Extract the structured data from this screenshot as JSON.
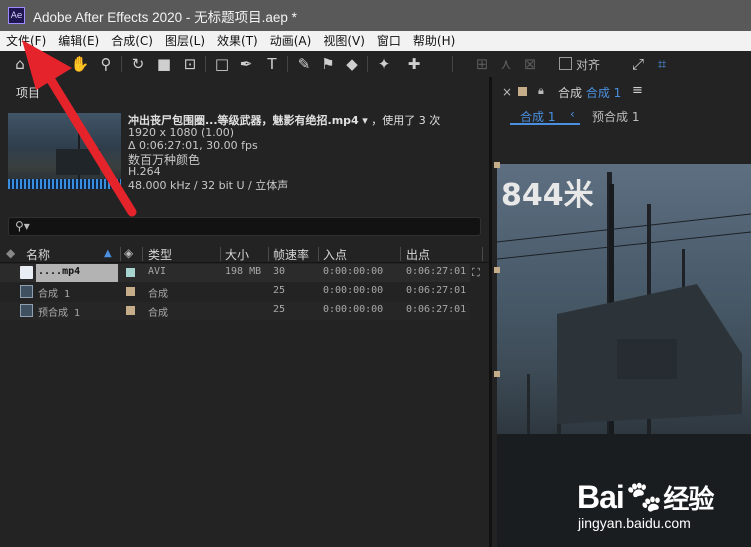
{
  "app": {
    "logo_text": "Ae",
    "title": "Adobe After Effects 2020 - 无标题项目.aep *"
  },
  "menu": [
    "文件(F)",
    "编辑(E)",
    "合成(C)",
    "图层(L)",
    "效果(T)",
    "动画(A)",
    "视图(V)",
    "窗口",
    "帮助(H)"
  ],
  "toolbar": {
    "snap_label": "对齐"
  },
  "project": {
    "panel_title": "项目",
    "selected_name": "冲出丧尸包围圈...等级武器，魅影有绝招.mp4",
    "used_text": "，使用了 3 次",
    "resolution": "1920 x 1080 (1.00)",
    "duration": "Δ 0:06:27:01, 30.00 fps",
    "colors": "数百万种颜色",
    "codec": "H.264",
    "audio": "48.000 kHz / 32 bit U / 立体声",
    "search_icon_text": "⚲▾",
    "columns": {
      "name": "名称",
      "type": "类型",
      "size": "大小",
      "fps": "帧速率",
      "in": "入点",
      "out": "出点"
    },
    "rows": [
      {
        "name": "....mp4",
        "type": "AVI",
        "size": "198 MB",
        "fps": "30",
        "in": "0:00:00:00",
        "out": "0:06:27:01",
        "label_color": "#a8d4d0"
      },
      {
        "name": "合成 1",
        "type": "合成",
        "size": "",
        "fps": "25",
        "in": "0:00:00:00",
        "out": "0:06:27:01",
        "label_color": "#c5ad8a"
      },
      {
        "name": "预合成 1",
        "type": "合成",
        "size": "",
        "fps": "25",
        "in": "0:00:00:00",
        "out": "0:06:27:01",
        "label_color": "#c5ad8a"
      }
    ]
  },
  "composition": {
    "close_glyph": "×",
    "panel_label": "合成",
    "active_comp": "合成 1",
    "menu_glyph": "≡",
    "breadcrumb": [
      "合成 1",
      "预合成 1"
    ],
    "overlay_text": "844米"
  },
  "watermark": {
    "brand": "Bai",
    "brand2": "经验",
    "url": "jingyan.baidu.com"
  },
  "colors": {
    "accent_blue": "#4a8fe0",
    "annotation_red": "#e5232b"
  }
}
